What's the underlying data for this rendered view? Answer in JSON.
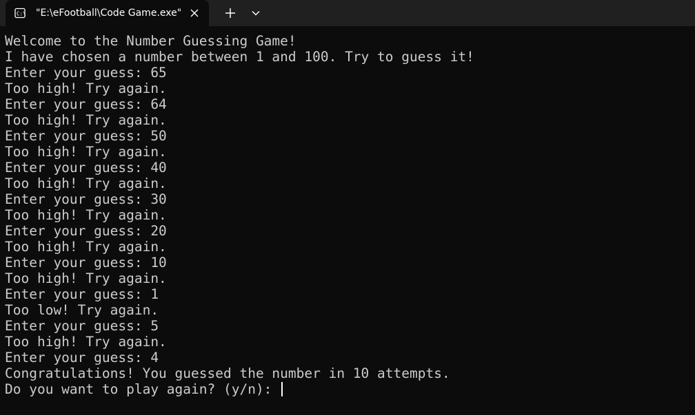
{
  "window": {
    "tab_title": "\"E:\\eFootball\\Code Game.exe\"",
    "tab_icon": "console-icon",
    "close_icon": "close-icon",
    "new_tab_icon": "plus-icon",
    "dropdown_icon": "chevron-down-icon"
  },
  "terminal": {
    "lines": [
      "Welcome to the Number Guessing Game!",
      "I have chosen a number between 1 and 100. Try to guess it!",
      "Enter your guess: 65",
      "Too high! Try again.",
      "Enter your guess: 64",
      "Too high! Try again.",
      "Enter your guess: 50",
      "Too high! Try again.",
      "Enter your guess: 40",
      "Too high! Try again.",
      "Enter your guess: 30",
      "Too high! Try again.",
      "Enter your guess: 20",
      "Too high! Try again.",
      "Enter your guess: 10",
      "Too high! Try again.",
      "Enter your guess: 1",
      "Too low! Try again.",
      "Enter your guess: 5",
      "Too high! Try again.",
      "Enter your guess: 4",
      "Congratulations! You guessed the number in 10 attempts."
    ],
    "prompt": "Do you want to play again? (y/n): ",
    "colors": {
      "background": "#0c0c0c",
      "foreground": "#cccccc",
      "tabbar": "#202020"
    }
  }
}
